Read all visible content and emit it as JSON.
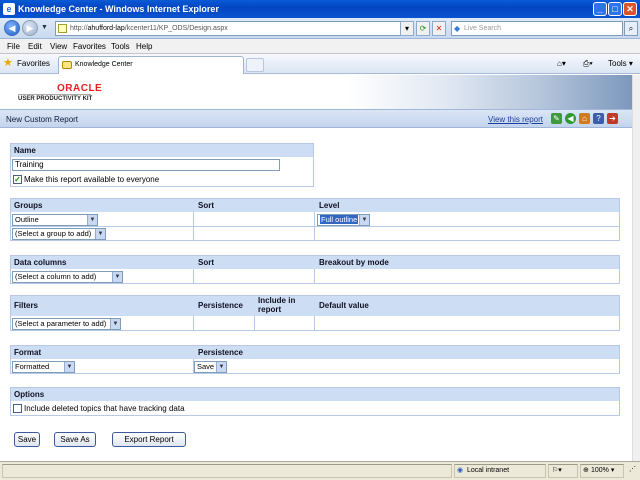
{
  "window": {
    "title": "Knowledge Center - Windows Internet Explorer",
    "minimize": "_",
    "maximize": "□",
    "close": "✕"
  },
  "address": {
    "url_prefix": "http://",
    "url_host": "ahufford-lap",
    "url_path": "/kcenter11/KP_ODS/Design.aspx",
    "search_placeholder": "Live Search"
  },
  "menu": [
    "File",
    "Edit",
    "View",
    "Favorites",
    "Tools",
    "Help"
  ],
  "favorites": {
    "favorites_label": "Favorites",
    "tab_label": "Knowledge Center",
    "tools_label": "Tools"
  },
  "banner": {
    "brand": "ORACLE",
    "product": "USER PRODUCTIVITY KIT"
  },
  "header": {
    "title": "New Custom Report",
    "view_link": "View this report"
  },
  "name_section": {
    "heading": "Name",
    "value": "Training",
    "share_label": "Make this report available to everyone",
    "share_checked": true
  },
  "groups_section": {
    "heading": "Groups",
    "sort_heading": "Sort",
    "level_heading": "Level",
    "group_value": "Outline",
    "add_group_placeholder": "(Select a group to add)",
    "level_value": "Full outline"
  },
  "data_section": {
    "heading": "Data columns",
    "sort_heading": "Sort",
    "breakout_heading": "Breakout by mode",
    "add_column_placeholder": "(Select a column to add)"
  },
  "filters_section": {
    "heading": "Filters",
    "persistence_heading": "Persistence",
    "include_heading": "Include in report",
    "default_heading": "Default value",
    "add_parameter_placeholder": "(Select a parameter to add)"
  },
  "format_section": {
    "heading": "Format",
    "persistence_heading": "Persistence",
    "format_value": "Formatted",
    "persistence_value": "Save"
  },
  "options_section": {
    "heading": "Options",
    "deleted_topics_label": "Include deleted topics that have tracking data",
    "deleted_topics_checked": false
  },
  "actions": {
    "save": "Save",
    "save_as": "Save As",
    "export": "Export Report"
  },
  "status": {
    "zone": "Local intranet",
    "zoom": "100%"
  }
}
